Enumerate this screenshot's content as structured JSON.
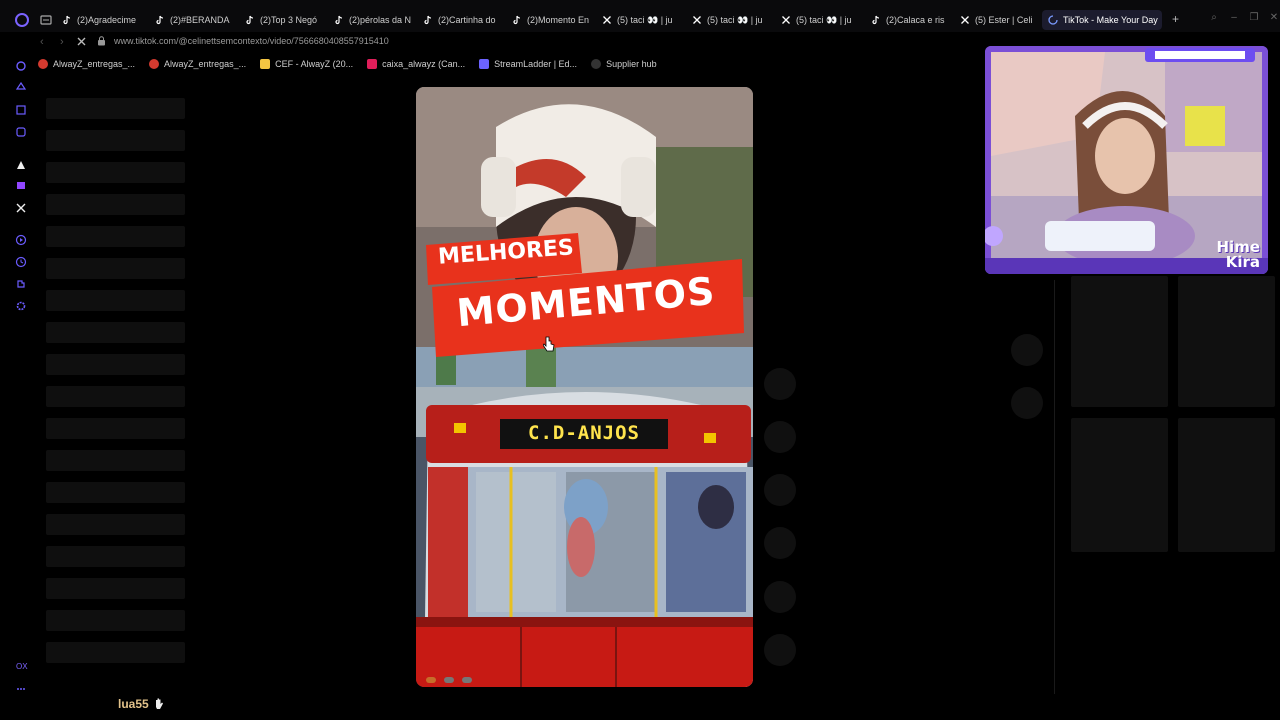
{
  "browser": {
    "tabs": [
      {
        "label": "(2)Agradecime"
      },
      {
        "label": "(2)#BERANDA"
      },
      {
        "label": "(2)Top 3 Negó"
      },
      {
        "label": "(2)pérolas da N"
      },
      {
        "label": "(2)Cartinha do"
      },
      {
        "label": "(2)Momento En"
      },
      {
        "label": "(5) taci 👀 | ju"
      },
      {
        "label": "(5) taci 👀 | ju"
      },
      {
        "label": "(5) taci 👀 | ju"
      },
      {
        "label": "(2)Calaca e ris"
      },
      {
        "label": "(5) Ester | Celi"
      }
    ],
    "active_tab": {
      "label": "TikTok - Make Your Day"
    },
    "new_tab_label": "+",
    "url": "www.tiktok.com/@celinettsemcontexto/video/7566680408557915410",
    "bookmarks": [
      {
        "label": "AlwayZ_entregas_..."
      },
      {
        "label": "AlwayZ_entregas_..."
      },
      {
        "label": "CEF - AlwayZ (20..."
      },
      {
        "label": "caixa_alwayz (Can..."
      },
      {
        "label": "StreamLadder | Ed..."
      },
      {
        "label": "Supplier hub"
      }
    ]
  },
  "video": {
    "title_line1": "MELHORES",
    "title_line2": "MOMENTOS",
    "bus_sign": "C.D-ANJOS"
  },
  "webcam": {
    "brand_line1": "Hime",
    "brand_line2": "Kira"
  },
  "chat": {
    "username": "lua55"
  },
  "sidebar_bottom": {
    "label": "OX"
  },
  "colors": {
    "background": "#000000",
    "banner_red": "#e8321c",
    "sign_yellow": "#ffe44d",
    "webcam_frame": "#7b4fd6",
    "accent": "#6b5cff"
  }
}
